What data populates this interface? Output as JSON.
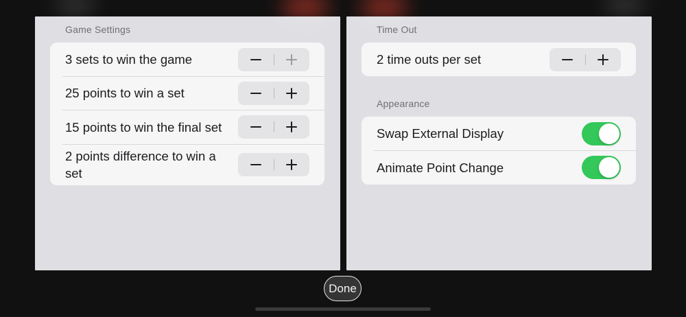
{
  "left_panel": {
    "header": "Game Settings",
    "rows": [
      {
        "label": "3 sets to win the game"
      },
      {
        "label": "25 points to win a set"
      },
      {
        "label": "15 points to win the final set"
      },
      {
        "label": "2 points difference to win a set"
      }
    ]
  },
  "right_panel": {
    "time_out": {
      "header": "Time Out",
      "rows": [
        {
          "label": "2 time outs per set"
        }
      ]
    },
    "appearance": {
      "header": "Appearance",
      "rows": [
        {
          "label": "Swap External Display",
          "on": true
        },
        {
          "label": "Animate Point Change",
          "on": true
        }
      ]
    }
  },
  "done_label": "Done",
  "colors": {
    "toggle_on": "#34c759",
    "stepper_icon": "#1c1c1e",
    "stepper_icon_disabled": "#9a9aa0"
  },
  "icons": {
    "minus": "minus-icon",
    "plus": "plus-icon"
  }
}
